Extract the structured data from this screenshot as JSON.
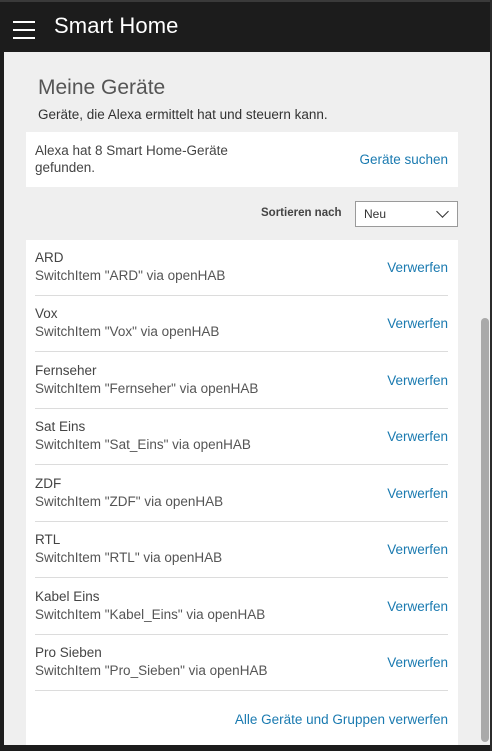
{
  "header": {
    "title": "Smart Home",
    "menu_icon": "hamburger-menu-icon"
  },
  "page": {
    "title": "Meine Geräte",
    "subtitle": "Geräte, die Alexa ermittelt hat und steuern kann."
  },
  "found": {
    "text": "Alexa hat 8 Smart Home-Geräte gefunden.",
    "search_label": "Geräte suchen"
  },
  "sort": {
    "label": "Sortieren nach",
    "value": "Neu"
  },
  "devices": [
    {
      "name": "ARD",
      "desc": "SwitchItem \"ARD\" via openHAB",
      "action": "Verwerfen"
    },
    {
      "name": "Vox",
      "desc": "SwitchItem \"Vox\" via openHAB",
      "action": "Verwerfen"
    },
    {
      "name": "Fernseher",
      "desc": "SwitchItem \"Fernseher\" via openHAB",
      "action": "Verwerfen"
    },
    {
      "name": "Sat Eins",
      "desc": "SwitchItem \"Sat_Eins\" via openHAB",
      "action": "Verwerfen"
    },
    {
      "name": "ZDF",
      "desc": "SwitchItem \"ZDF\" via openHAB",
      "action": "Verwerfen"
    },
    {
      "name": "RTL",
      "desc": "SwitchItem \"RTL\" via openHAB",
      "action": "Verwerfen"
    },
    {
      "name": "Kabel Eins",
      "desc": "SwitchItem \"Kabel_Eins\" via openHAB",
      "action": "Verwerfen"
    },
    {
      "name": "Pro Sieben",
      "desc": "SwitchItem \"Pro_Sieben\" via openHAB",
      "action": "Verwerfen"
    }
  ],
  "discard_all_label": "Alle Geräte und Gruppen verwerfen",
  "colors": {
    "header_bg": "#1c1c1c",
    "content_bg": "#efefef",
    "link": "#1a7ab0"
  }
}
